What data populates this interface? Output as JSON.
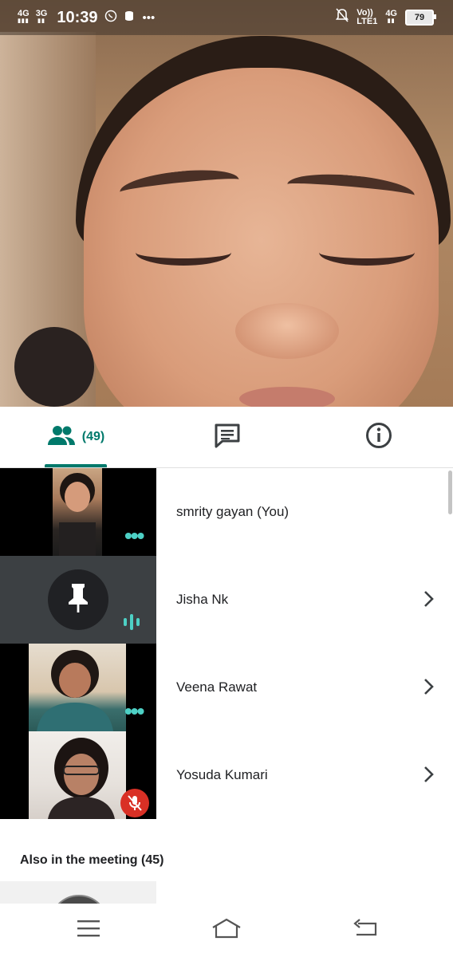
{
  "status_bar": {
    "network_1": "4G",
    "network_2": "3G",
    "time": "10:39",
    "volte": "Vo))",
    "lte": "LTE1",
    "network_3": "4G",
    "battery": "79"
  },
  "tabs": {
    "people_count": "(49)"
  },
  "participants": [
    {
      "name": "smrity gayan (You)"
    },
    {
      "name": "Jisha Nk"
    },
    {
      "name": "Veena Rawat"
    },
    {
      "name": "Yosuda Kumari"
    }
  ],
  "also_in_meeting": "Also in the meeting (45)",
  "colors": {
    "accent": "#00796b",
    "speaking": "#4dd0c5",
    "muted": "#d93025"
  }
}
